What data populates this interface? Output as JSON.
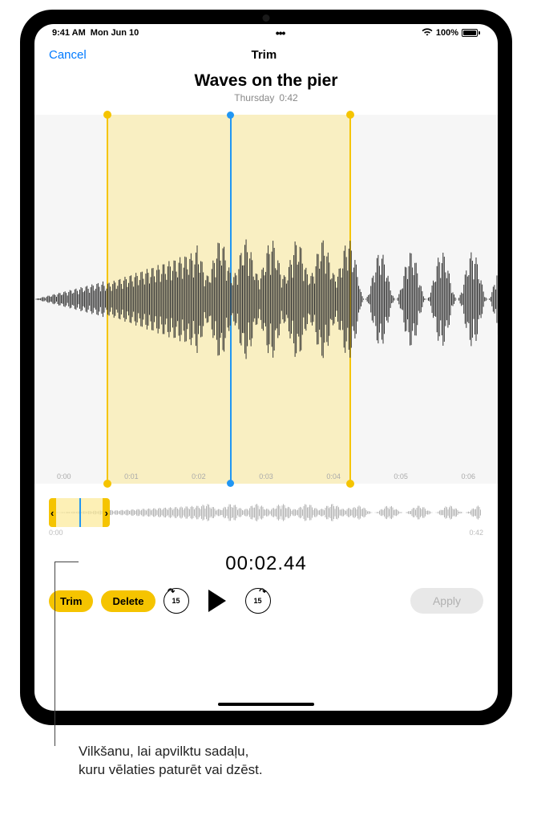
{
  "status": {
    "time": "9:41 AM",
    "date": "Mon Jun 10",
    "battery": "100%"
  },
  "nav": {
    "cancel": "Cancel",
    "title": "Trim"
  },
  "recording": {
    "title": "Waves on the pier",
    "day": "Thursday",
    "duration": "0:42"
  },
  "waveform_ticks": [
    "0:00",
    "0:01",
    "0:02",
    "0:03",
    "0:04",
    "0:05",
    "0:06"
  ],
  "overview_ticks": {
    "start": "0:00",
    "end": "0:42"
  },
  "playback": {
    "timer": "00:02.44",
    "skip_seconds": "15"
  },
  "controls": {
    "trim": "Trim",
    "delete": "Delete",
    "apply": "Apply"
  },
  "caption": {
    "line1": "Vilkšanu, lai apvilktu sadaļu,",
    "line2": "kuru vēlaties paturēt vai dzēst."
  }
}
